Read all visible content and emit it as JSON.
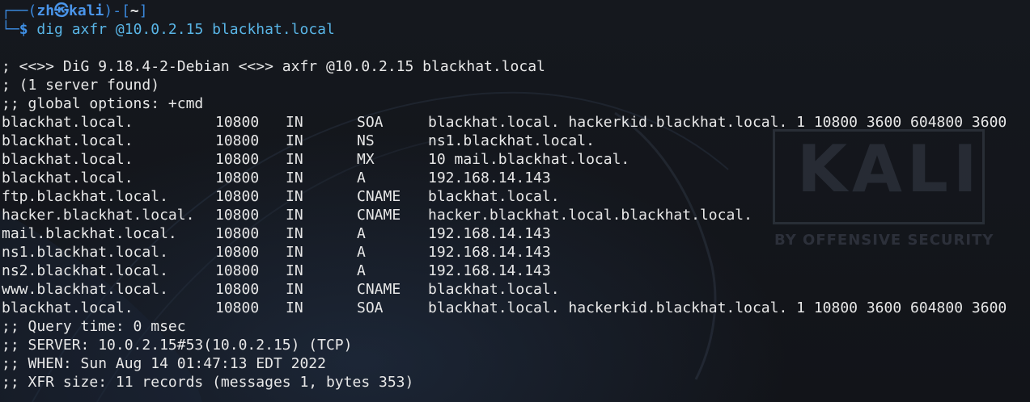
{
  "prompt": {
    "user": "zh",
    "separator_icon": "kali-dragon-icon",
    "host": "kali",
    "cwd": "~",
    "symbol": "$",
    "command": "dig axfr @10.0.2.15 blackhat.local"
  },
  "output": {
    "header": [
      "; <<>> DiG 9.18.4-2-Debian <<>> axfr @10.0.2.15 blackhat.local",
      "; (1 server found)",
      ";; global options: +cmd"
    ],
    "records": [
      {
        "name": "blackhat.local.",
        "ttl": "10800",
        "class": "IN",
        "type": "SOA",
        "data": "blackhat.local. hackerkid.blackhat.local. 1 10800 3600 604800 3600"
      },
      {
        "name": "blackhat.local.",
        "ttl": "10800",
        "class": "IN",
        "type": "NS",
        "data": "ns1.blackhat.local."
      },
      {
        "name": "blackhat.local.",
        "ttl": "10800",
        "class": "IN",
        "type": "MX",
        "data": "10 mail.blackhat.local."
      },
      {
        "name": "blackhat.local.",
        "ttl": "10800",
        "class": "IN",
        "type": "A",
        "data": "192.168.14.143"
      },
      {
        "name": "ftp.blackhat.local.",
        "ttl": "10800",
        "class": "IN",
        "type": "CNAME",
        "data": "blackhat.local."
      },
      {
        "name": "hacker.blackhat.local.",
        "ttl": "10800",
        "class": "IN",
        "type": "CNAME",
        "data": "hacker.blackhat.local.blackhat.local."
      },
      {
        "name": "mail.blackhat.local.",
        "ttl": "10800",
        "class": "IN",
        "type": "A",
        "data": "192.168.14.143"
      },
      {
        "name": "ns1.blackhat.local.",
        "ttl": "10800",
        "class": "IN",
        "type": "A",
        "data": "192.168.14.143"
      },
      {
        "name": "ns2.blackhat.local.",
        "ttl": "10800",
        "class": "IN",
        "type": "A",
        "data": "192.168.14.143"
      },
      {
        "name": "www.blackhat.local.",
        "ttl": "10800",
        "class": "IN",
        "type": "CNAME",
        "data": "blackhat.local."
      },
      {
        "name": "blackhat.local.",
        "ttl": "10800",
        "class": "IN",
        "type": "SOA",
        "data": "blackhat.local. hackerkid.blackhat.local. 1 10800 3600 604800 3600"
      }
    ],
    "footer": [
      ";; Query time: 0 msec",
      ";; SERVER: 10.0.2.15#53(10.0.2.15) (TCP)",
      ";; WHEN: Sun Aug 14 01:47:13 EDT 2022",
      ";; XFR size: 11 records (messages 1, bytes 353)"
    ]
  },
  "wallpaper": {
    "logo_word": "KALI",
    "logo_tagline": "BY OFFENSIVE SECURITY",
    "logo_icon": "kali-dragon-icon"
  },
  "colors": {
    "background": "#14171c",
    "prompt_accent": "#3f8fe4",
    "text": "#e8e8e8",
    "command": "#59b5e6"
  }
}
